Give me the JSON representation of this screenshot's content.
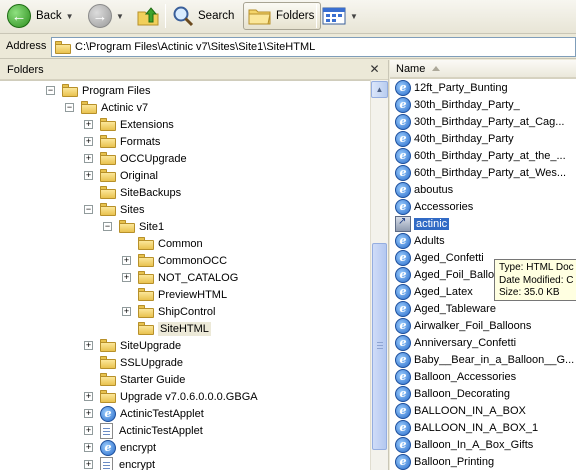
{
  "toolbar": {
    "back_label": "Back",
    "search_label": "Search",
    "folders_label": "Folders"
  },
  "address": {
    "label": "Address",
    "path": "C:\\Program Files\\Actinic v7\\Sites\\Site1\\SiteHTML"
  },
  "folders_pane": {
    "title": "Folders",
    "tree": [
      {
        "label": "Program Files",
        "expander": "minus",
        "icon": "folder-icon"
      },
      {
        "label": "Actinic v7",
        "expander": "minus",
        "icon": "folder-icon"
      },
      {
        "label": "Extensions",
        "expander": "plus",
        "icon": "folder-icon"
      },
      {
        "label": "Formats",
        "expander": "plus",
        "icon": "folder-icon"
      },
      {
        "label": "OCCUpgrade",
        "expander": "plus",
        "icon": "folder-icon"
      },
      {
        "label": "Original",
        "expander": "plus",
        "icon": "folder-icon"
      },
      {
        "label": "SiteBackups",
        "expander": "none",
        "icon": "folder-icon"
      },
      {
        "label": "Sites",
        "expander": "minus",
        "icon": "folder-icon"
      },
      {
        "label": "Site1",
        "expander": "minus",
        "icon": "folder-icon"
      },
      {
        "label": "Common",
        "expander": "none",
        "icon": "folder-icon"
      },
      {
        "label": "CommonOCC",
        "expander": "plus",
        "icon": "folder-icon"
      },
      {
        "label": "NOT_CATALOG",
        "expander": "plus",
        "icon": "folder-icon"
      },
      {
        "label": "PreviewHTML",
        "expander": "none",
        "icon": "folder-icon"
      },
      {
        "label": "ShipControl",
        "expander": "plus",
        "icon": "folder-icon"
      },
      {
        "label": "SiteHTML",
        "expander": "none",
        "icon": "folder-open-icon"
      },
      {
        "label": "SiteUpgrade",
        "expander": "plus",
        "icon": "folder-icon"
      },
      {
        "label": "SSLUpgrade",
        "expander": "none",
        "icon": "folder-icon"
      },
      {
        "label": "Starter Guide",
        "expander": "none",
        "icon": "folder-icon"
      },
      {
        "label": "Upgrade v7.0.6.0.0.0.GBGA",
        "expander": "plus",
        "icon": "folder-icon"
      },
      {
        "label": "ActinicTestApplet",
        "expander": "plus",
        "icon": "ie-icon"
      },
      {
        "label": "ActinicTestApplet",
        "expander": "plus",
        "icon": "file-icon"
      },
      {
        "label": "encrypt",
        "expander": "plus",
        "icon": "ie-icon"
      },
      {
        "label": "encrypt",
        "expander": "plus",
        "icon": "file-icon"
      }
    ]
  },
  "file_list": {
    "column_name": "Name",
    "items": [
      "12ft_Party_Bunting",
      "30th_Birthday_Party_",
      "30th_Birthday_Party_at_Cag...",
      "40th_Birthday_Party",
      "60th_Birthday_Party_at_the_...",
      "60th_Birthday_Party_at_Wes...",
      "aboutus",
      "Accessories",
      "actinic",
      "Adults",
      "Aged_Confetti",
      "Aged_Foil_Balloo",
      "Aged_Latex",
      "Aged_Tableware",
      "Airwalker_Foil_Balloons",
      "Anniversary_Confetti",
      "Baby__Bear_in_a_Balloon__G...",
      "Balloon_Accessories",
      "Balloon_Decorating",
      "BALLOON_IN_A_BOX",
      "BALLOON_IN_A_BOX_1",
      "Balloon_In_A_Box_Gifts",
      "Balloon_Printing"
    ],
    "selected": "actinic"
  },
  "tooltip": {
    "type_line": "Type: HTML Doc",
    "modified_line": "Date Modified: C",
    "size_line": "Size: 35.0 KB"
  },
  "colors": {
    "selection_blue": "#316ac5",
    "tooltip_bg": "#ffffe1",
    "xp_face": "#ece9d8"
  }
}
